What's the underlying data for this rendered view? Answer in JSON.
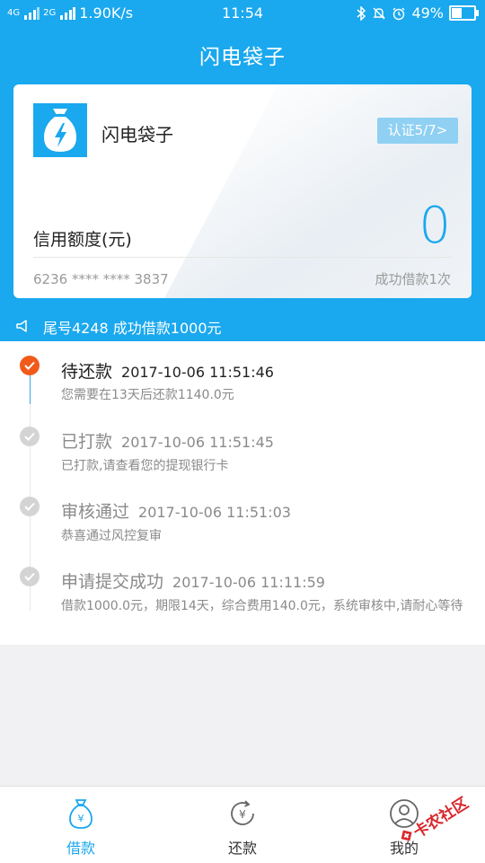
{
  "status_bar": {
    "network_left": "4G",
    "network_sub": "4G",
    "network_right": "2G",
    "speed": "1.90K/s",
    "time": "11:54",
    "battery_percent": "49%",
    "battery_level": 0.49
  },
  "header": {
    "title": "闪电袋子"
  },
  "card": {
    "name": "闪电袋子",
    "certification": "认证5/7>",
    "credit_label": "信用额度(元)",
    "credit_value": "0",
    "card_number": "6236 **** **** 3837",
    "success_count": "成功借款1次"
  },
  "notice": {
    "text": "尾号4248 成功借款1000元"
  },
  "timeline": [
    {
      "status": "待还款",
      "time": "2017-10-06 11:51:46",
      "desc": "您需要在13天后还款1140.0元"
    },
    {
      "status": "已打款",
      "time": "2017-10-06 11:51:45",
      "desc": "已打款,请查看您的提现银行卡"
    },
    {
      "status": "审核通过",
      "time": "2017-10-06 11:51:03",
      "desc": "恭喜通过风控复审"
    },
    {
      "status": "申请提交成功",
      "time": "2017-10-06 11:11:59",
      "desc": "借款1000.0元，期限14天，综合费用140.0元，系统审核中,请耐心等待"
    }
  ],
  "nav": [
    {
      "label": "借款",
      "icon": "money-bag-icon"
    },
    {
      "label": "还款",
      "icon": "repay-icon"
    },
    {
      "label": "我的",
      "icon": "profile-icon"
    }
  ],
  "watermark": {
    "text": "卡农社区"
  },
  "colors": {
    "primary": "#1aa8ee",
    "active_dot": "#f05a1a",
    "inactive": "#d4d4d4"
  }
}
